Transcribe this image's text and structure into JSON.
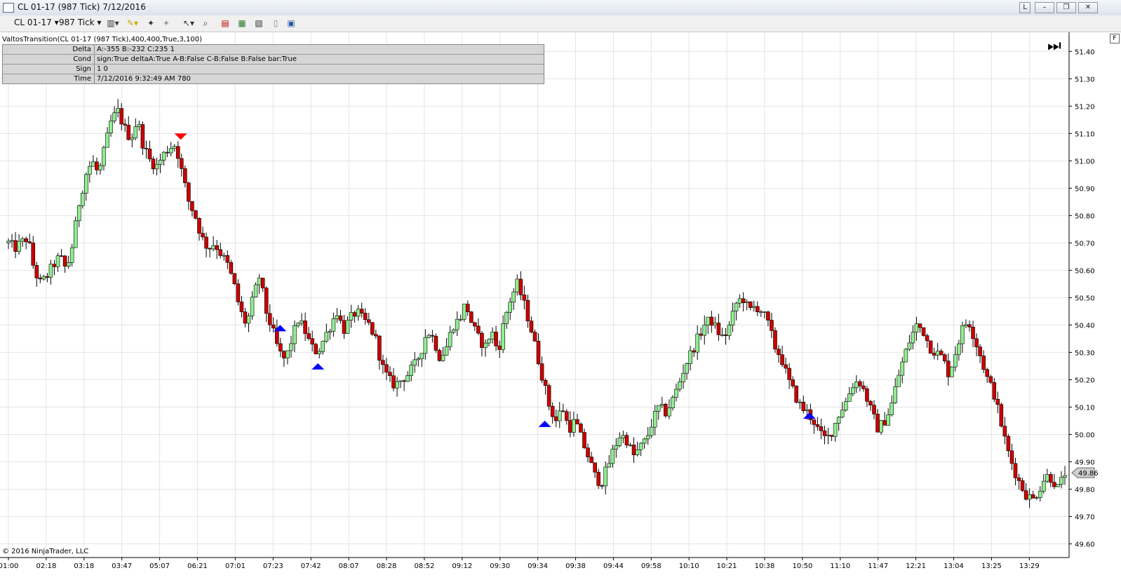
{
  "window": {
    "title": "CL 01-17 (987 Tick)  7/12/2016",
    "buttons": [
      "L",
      "–",
      "❐",
      "✕"
    ]
  },
  "toolbar": {
    "instrument": "CL 01-17",
    "period": "987 Tick",
    "icons": [
      "bars-icon",
      "pencil-icon",
      "pin-icon",
      "cursor-icon",
      "zoom-icon",
      "data-box-icon",
      "chart-properties-icon",
      "indicator-icon",
      "strategy-icon",
      "tab-icon"
    ]
  },
  "indicator": {
    "label": "ValtosTransition(CL 01-17 (987 Tick),400,400,True,3,100)",
    "rows": [
      {
        "key": "Delta",
        "value": "A:-355 B:-232 C:235 1"
      },
      {
        "key": "Cond",
        "value": "sign:True deltaA:True A-B:False C-B:False B:False bar:True"
      },
      {
        "key": "Sign",
        "value": "1 0"
      },
      {
        "key": "Time",
        "value": "7/12/2016 9:32:49 AM 780"
      }
    ]
  },
  "copyright": "© 2016 NinjaTrader, LLC",
  "corner_label": "F",
  "chart_data": {
    "type": "candlestick",
    "y_ticks": [
      "51.40",
      "51.30",
      "51.20",
      "51.10",
      "51.00",
      "50.90",
      "50.80",
      "50.70",
      "50.60",
      "50.50",
      "50.40",
      "50.30",
      "50.20",
      "50.10",
      "50.00",
      "49.90",
      "49.80",
      "49.70",
      "49.60"
    ],
    "ylim": [
      49.55,
      51.47
    ],
    "x_ticks": [
      "01:00",
      "02:18",
      "03:18",
      "03:47",
      "05:07",
      "06:21",
      "07:01",
      "07:23",
      "07:42",
      "08:07",
      "08:28",
      "08:52",
      "09:12",
      "09:30",
      "09:34",
      "09:38",
      "09:44",
      "09:58",
      "10:10",
      "10:21",
      "10:38",
      "10:50",
      "11:10",
      "11:47",
      "12:21",
      "13:04",
      "13:25",
      "13:29"
    ],
    "last_price": "49.86",
    "close_path": [
      50.7,
      50.68,
      50.7,
      50.72,
      50.6,
      50.55,
      50.58,
      50.62,
      50.65,
      50.6,
      50.7,
      50.85,
      50.95,
      51.0,
      50.95,
      51.05,
      51.15,
      51.18,
      51.12,
      51.08,
      51.15,
      51.05,
      51.0,
      50.98,
      51.02,
      51.05,
      51.06,
      50.95,
      50.85,
      50.8,
      50.72,
      50.68,
      50.7,
      50.66,
      50.62,
      50.55,
      50.45,
      50.4,
      50.5,
      50.58,
      50.45,
      50.38,
      50.3,
      50.27,
      50.35,
      50.42,
      50.38,
      50.32,
      50.3,
      50.35,
      50.4,
      50.45,
      50.38,
      50.42,
      50.45,
      50.42,
      50.4,
      50.35,
      50.25,
      50.2,
      50.18,
      50.2,
      50.22,
      50.25,
      50.3,
      50.38,
      50.35,
      50.28,
      50.32,
      50.4,
      50.42,
      50.48,
      50.4,
      50.35,
      50.32,
      50.38,
      50.3,
      50.42,
      50.5,
      50.55,
      50.48,
      50.4,
      50.3,
      50.2,
      50.1,
      50.05,
      50.1,
      50.02,
      50.05,
      49.98,
      49.92,
      49.85,
      49.82,
      49.88,
      49.95,
      50.0,
      49.98,
      49.92,
      49.95,
      49.98,
      50.05,
      50.1,
      50.08,
      50.12,
      50.18,
      50.25,
      50.3,
      50.35,
      50.4,
      50.42,
      50.38,
      50.35,
      50.4,
      50.48,
      50.5,
      50.45,
      50.47,
      50.45,
      50.4,
      50.32,
      50.28,
      50.2,
      50.15,
      50.1,
      50.08,
      50.05,
      50.0,
      49.98,
      50.02,
      50.08,
      50.12,
      50.18,
      50.2,
      50.15,
      50.08,
      50.02,
      50.05,
      50.1,
      50.2,
      50.28,
      50.35,
      50.4,
      50.38,
      50.32,
      50.3,
      50.28,
      50.22,
      50.3,
      50.38,
      50.42,
      50.35,
      50.28,
      50.2,
      50.15,
      50.05,
      49.95,
      49.88,
      49.82,
      49.78,
      49.76,
      49.8,
      49.85,
      49.84,
      49.8,
      49.86
    ],
    "signals": [
      {
        "type": "sell",
        "time": "05:07",
        "price": 51.09
      },
      {
        "type": "buy",
        "time": "07:23",
        "price": 50.39
      },
      {
        "type": "buy",
        "time": "07:42",
        "price": 50.25
      },
      {
        "type": "buy",
        "time": "09:34",
        "price": 50.04
      },
      {
        "type": "buy",
        "time": "10:50",
        "price": 50.07
      }
    ],
    "colors": {
      "up": "#90ee90",
      "down": "#cc0000",
      "wick": "#000000",
      "grid": "#e4e4e4",
      "sell_marker": "#ff0000",
      "buy_marker": "#0000ff"
    }
  }
}
